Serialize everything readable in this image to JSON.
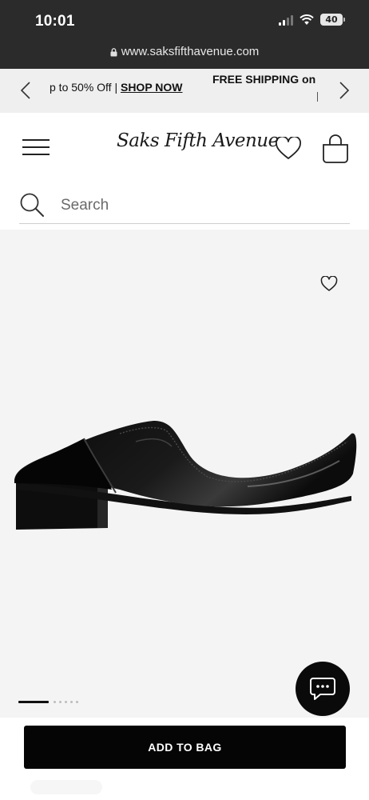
{
  "status": {
    "time": "10:01",
    "battery": "40"
  },
  "browser": {
    "url": "www.saksfifthavenue.com"
  },
  "promo": {
    "left_text": "p to 50% Off | ",
    "left_link": "SHOP NOW",
    "right_text": "FREE SHIPPING on S"
  },
  "header": {
    "logo": "Saks Fifth Avenue"
  },
  "search": {
    "placeholder": "Search"
  },
  "product": {
    "image_alt": "black patent leather slip-on loafer mule",
    "carousel_total": 6,
    "carousel_active": 1
  },
  "cta": {
    "add_to_bag": "ADD TO BAG"
  },
  "icons": {
    "menu": "hamburger-menu-icon",
    "wishlist": "heart-icon",
    "bag": "shopping-bag-icon",
    "search": "search-icon",
    "chat": "chat-bubble-icon",
    "prev": "chevron-left-icon",
    "next": "chevron-right-icon"
  }
}
